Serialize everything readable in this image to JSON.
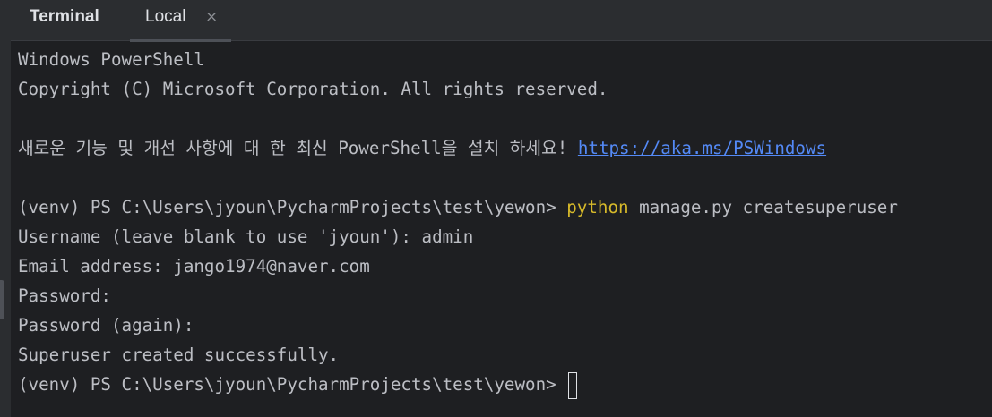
{
  "header": {
    "title": "Terminal",
    "tab_label": "Local",
    "tab_close_glyph": "×"
  },
  "colors": {
    "background": "#1e1f22",
    "text": "#bcbec4",
    "command_highlight": "#d6b92a",
    "link": "#548af7"
  },
  "terminal": {
    "line1": "Windows PowerShell",
    "line2": "Copyright (C) Microsoft Corporation. All rights reserved.",
    "line3_text": "새로운 기능 및 개선 사항에 대 한 최신 PowerShell을 설치 하세요! ",
    "line3_link": "https://aka.ms/PSWindows",
    "line4_prompt": "(venv) PS C:\\Users\\jyoun\\PycharmProjects\\test\\yewon> ",
    "line4_cmd": "python",
    "line4_args": " manage.py createsuperuser",
    "line5": "Username (leave blank to use 'jyoun'): admin",
    "line6": "Email address: jango1974@naver.com",
    "line7": "Password:",
    "line8": "Password (again):",
    "line9": "Superuser created successfully.",
    "line10_prompt": "(venv) PS C:\\Users\\jyoun\\PycharmProjects\\test\\yewon> "
  }
}
